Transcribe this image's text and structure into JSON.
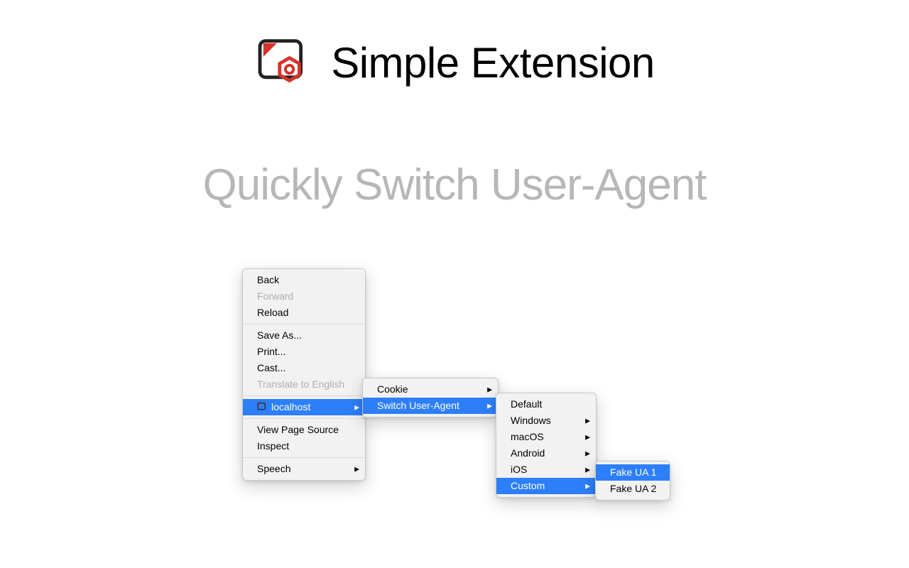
{
  "header": {
    "app_title": "Simple Extension",
    "subtitle": "Quickly Switch User-Agent"
  },
  "context_menu": {
    "items": [
      {
        "label": "Back",
        "disabled": false
      },
      {
        "label": "Forward",
        "disabled": true
      },
      {
        "label": "Reload",
        "disabled": false
      },
      {
        "divider": true
      },
      {
        "label": "Save As...",
        "disabled": false
      },
      {
        "label": "Print...",
        "disabled": false
      },
      {
        "label": "Cast...",
        "disabled": false
      },
      {
        "label": "Translate to English",
        "disabled": true
      },
      {
        "divider": true
      },
      {
        "label": "localhost",
        "highlight": true,
        "has_submenu": true,
        "has_icon": true
      },
      {
        "divider": true
      },
      {
        "label": "View Page Source",
        "disabled": false
      },
      {
        "label": "Inspect",
        "disabled": false
      },
      {
        "divider": true
      },
      {
        "label": "Speech",
        "has_submenu": true
      }
    ],
    "submenu1": [
      {
        "label": "Cookie",
        "has_submenu": true
      },
      {
        "label": "Switch User-Agent",
        "has_submenu": true,
        "highlight": true
      }
    ],
    "submenu2": [
      {
        "label": "Default"
      },
      {
        "label": "Windows",
        "has_submenu": true
      },
      {
        "label": "macOS",
        "has_submenu": true
      },
      {
        "label": "Android",
        "has_submenu": true
      },
      {
        "label": "iOS",
        "has_submenu": true
      },
      {
        "label": "Custom",
        "has_submenu": true,
        "highlight": true
      }
    ],
    "submenu3": [
      {
        "label": "Fake UA 1",
        "highlight": true
      },
      {
        "label": "Fake UA 2"
      }
    ]
  }
}
